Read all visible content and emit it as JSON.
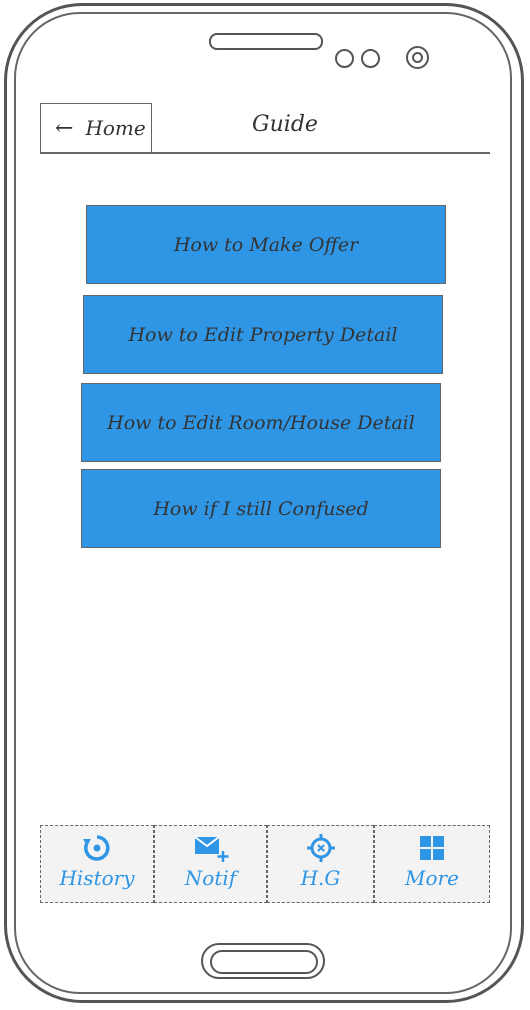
{
  "header": {
    "back_label": "Home",
    "title": "Guide"
  },
  "guide_buttons": [
    {
      "label": "How to Make Offer"
    },
    {
      "label": "How to Edit Property Detail"
    },
    {
      "label": "How to Edit Room/House Detail"
    },
    {
      "label": "How if I still Confused"
    }
  ],
  "tabbar": {
    "tabs": [
      {
        "label": "History",
        "icon": "history-icon"
      },
      {
        "label": "Notif",
        "icon": "mail-add-icon"
      },
      {
        "label": "H.G",
        "icon": "crosshair-icon"
      },
      {
        "label": "More",
        "icon": "grid-icon"
      }
    ]
  },
  "colors": {
    "accent": "#2f96e6",
    "frame": "#555555",
    "tab_bg": "#f3f3f3"
  }
}
